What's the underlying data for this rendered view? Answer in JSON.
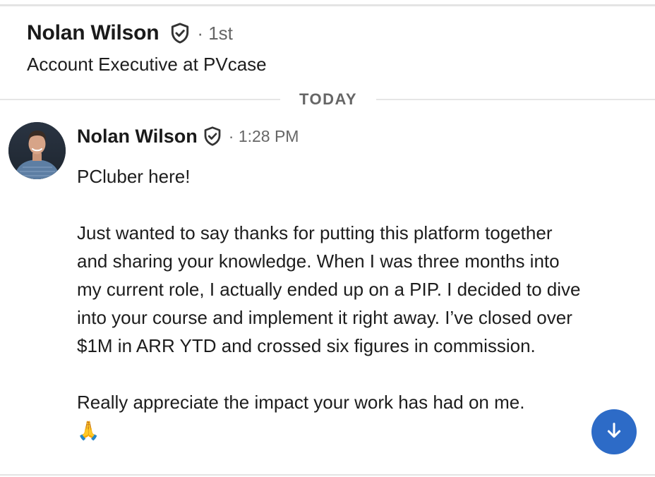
{
  "header": {
    "name": "Nolan Wilson",
    "badge_icon": "verified-shield-icon",
    "degree": "· 1st",
    "title": "Account Executive at PVcase"
  },
  "divider": {
    "label": "TODAY"
  },
  "message": {
    "sender": "Nolan Wilson",
    "badge_icon": "verified-shield-icon",
    "time": "· 1:28 PM",
    "paragraph_1": "PCluber here!",
    "paragraph_2": "Just wanted to say thanks for putting this platform together and sharing your knowledge. When I was three months into my current role, I actually ended up on a PIP. I decided to dive into your course and implement it right away. I’ve closed over $1M in ARR YTD and crossed six figures in commission.",
    "paragraph_3": "Really appreciate the impact your work has had on me.",
    "emoji": "🙏"
  },
  "scroll_button": {
    "icon": "arrow-down-icon"
  },
  "colors": {
    "accent": "#2d6bc7",
    "muted_text": "#666666",
    "divider": "#e6e6e6"
  }
}
